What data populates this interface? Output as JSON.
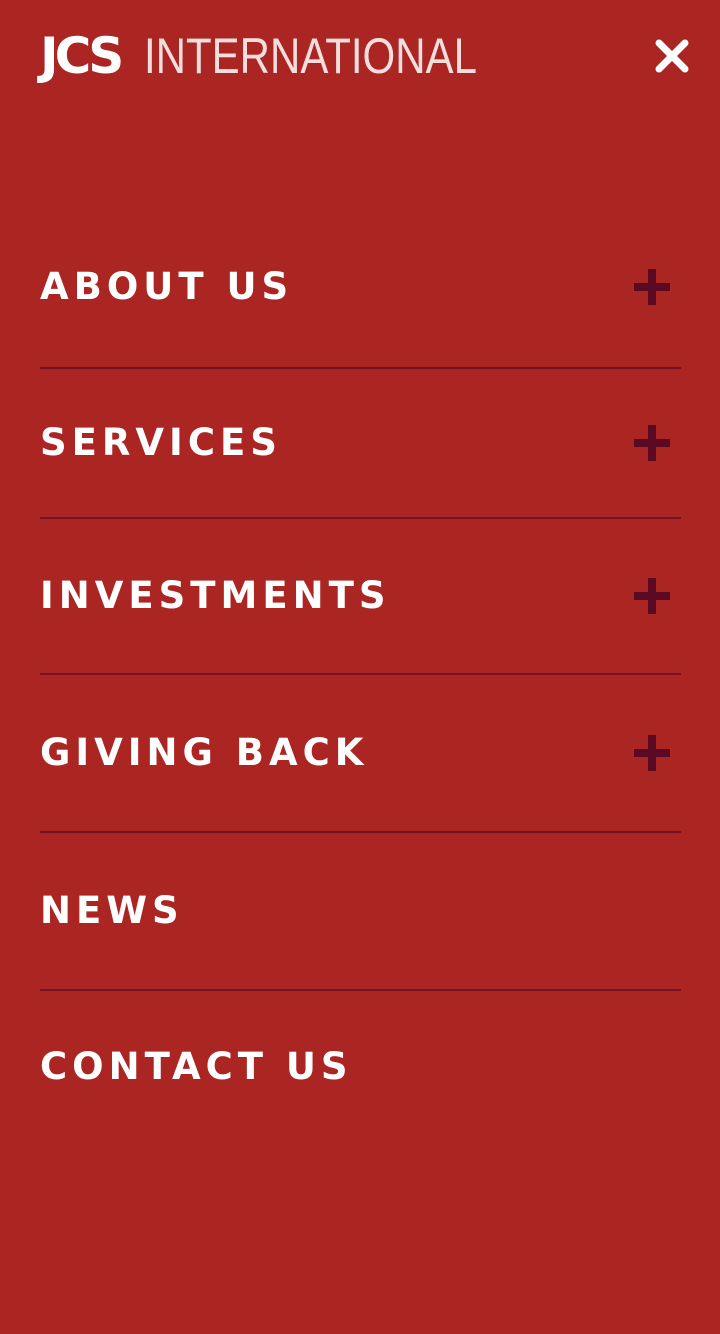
{
  "header": {
    "logo_mark": "JCS",
    "logo_word": "INTERNATIONAL",
    "close_icon": "close-icon"
  },
  "menu": {
    "items": [
      {
        "label": "ABOUT US",
        "expandable": true,
        "icon": "plus-icon"
      },
      {
        "label": "SERVICES",
        "expandable": true,
        "icon": "plus-icon"
      },
      {
        "label": "INVESTMENTS",
        "expandable": true,
        "icon": "plus-icon"
      },
      {
        "label": "GIVING BACK",
        "expandable": true,
        "icon": "plus-icon"
      },
      {
        "label": "NEWS",
        "expandable": false
      },
      {
        "label": "CONTACT US",
        "expandable": false
      }
    ]
  },
  "colors": {
    "background": "#ab2523",
    "divider": "#731323",
    "plus": "#5a0a22",
    "text": "#ffffff"
  }
}
